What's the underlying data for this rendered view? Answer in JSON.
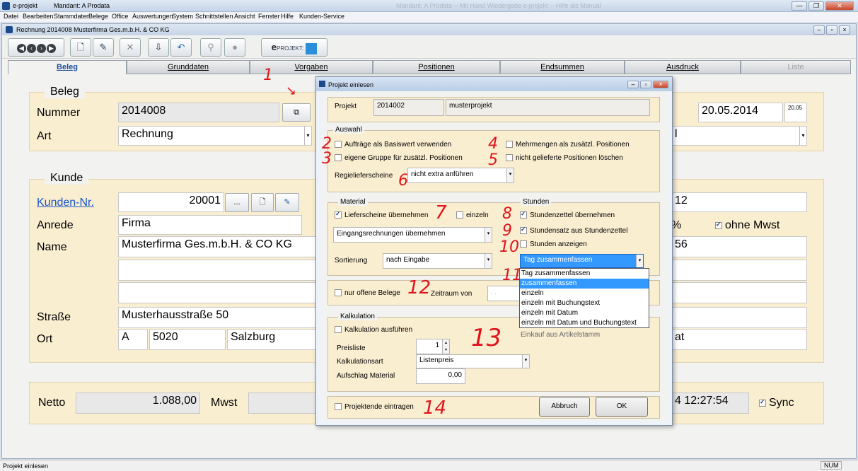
{
  "window": {
    "title": "e-projekt",
    "mandant": "Mandant: A Prodata",
    "ghost_title": "Mandant: A Prodata -- Mit Hand Wiedergabe e-projekt -- Hilfe als Manual"
  },
  "menu": [
    "Datei",
    "Bearbeiten",
    "Stammdaten",
    "Belege",
    "Office",
    "Auswertungen",
    "System",
    "Schnittstellen",
    "Ansicht",
    "Fenster",
    "Hilfe",
    "Kunden-Service"
  ],
  "document": {
    "title": "Rechnung  2014008  Musterfirma Ges.m.b.H. & CO KG",
    "logo_text": "PROJEKT:",
    "tabs": [
      {
        "label": "Beleg"
      },
      {
        "label": "Grunddaten"
      },
      {
        "label": "Vorgaben"
      },
      {
        "label": "Positionen"
      },
      {
        "label": "Endsummen"
      },
      {
        "label": "Ausdruck"
      },
      {
        "label": "Liste"
      }
    ],
    "beleg": {
      "title": "Beleg",
      "nummer_label": "Nummer",
      "nummer_value": "2014008",
      "art_label": "Art",
      "art_value": "Rechnung",
      "date_value": "20.05.2014",
      "time_value": "20.05",
      "right_partial": "l"
    },
    "kunde": {
      "title": "Kunde",
      "kunden_nr_label": "Kunden-Nr.",
      "kunden_nr_value": "20001",
      "kunden_nr_btn": "...",
      "anrede_label": "Anrede",
      "anrede_value": "Firma",
      "name_label": "Name",
      "name_value": "Musterfirma Ges.m.b.H. & CO KG",
      "strasse_label": "Straße",
      "strasse_value": "Musterhausstraße 50",
      "ort_label": "Ort",
      "land_value": "A",
      "plz_value": "5020",
      "ort_value": "Salzburg",
      "right_12": "12",
      "right_pct": "%",
      "ohne_mwst": "ohne Mwst",
      "right_56": "56",
      "right_at": "at"
    },
    "summen": {
      "netto_label": "Netto",
      "netto_value": "1.088,00",
      "mwst_label": "Mwst",
      "time_partial": "4 12:27:54",
      "sync_label": "Sync"
    }
  },
  "dialog": {
    "title": "Projekt einlesen",
    "projekt_label": "Projekt",
    "projekt_nr": "2014002",
    "projekt_name": "musterprojekt",
    "auswahl": {
      "title": "Auswahl",
      "auftraege": "Aufträge als Basiswert verwenden",
      "mehrmengen": "Mehrmengen als zusätzl. Positionen",
      "eigene_gruppe": "eigene Gruppe für zusätzl. Positionen",
      "nicht_geliefert": "nicht gelieferte Positionen löschen",
      "regie_label": "Regielieferscheine",
      "regie_value": "nicht extra anführen"
    },
    "material": {
      "title": "Material",
      "lieferscheine": "Lieferscheine übernehmen",
      "einzeln": "einzeln",
      "eingangsrechnungen": "Eingangsrechnungen übernehmen",
      "sortierung_label": "Sortierung",
      "sortierung_value": "nach Eingabe"
    },
    "stunden": {
      "title": "Stunden",
      "zettel": "Stundenzettel übernehmen",
      "satz": "Stundensatz aus Stundenzettel",
      "anzeigen": "Stunden anzeigen",
      "combo_value": "Tag zusammenfassen",
      "options": [
        "Tag zusammenfassen",
        "zusammenfassen",
        "einzeln",
        "einzeln mit Buchungstext",
        "einzeln mit Datum",
        "einzeln mit Datum und Buchungstext"
      ],
      "hidden_partial": "Einkauf aus Artikelstamm"
    },
    "offene": "nur offene Belege",
    "zeitraum": "Zeitraum  von",
    "zeitraum_value": ". .",
    "kalkulation": {
      "title": "Kalkulation",
      "ausfuehren": "Kalkulation ausführen",
      "preisliste_label": "Preisliste",
      "preisliste_value": "1",
      "art_label": "Kalkulationsart",
      "art_value": "Listenpreis",
      "aufschlag_label": "Aufschlag Material",
      "aufschlag_value": "0,00"
    },
    "projektende": "Projektende eintragen",
    "abbruch": "Abbruch",
    "ok": "OK"
  },
  "annotations": [
    "1",
    "2",
    "3",
    "4",
    "5",
    "6",
    "7",
    "8",
    "9",
    "10",
    "11",
    "12",
    "13",
    "14"
  ],
  "status": {
    "left": "Projekt einlesen",
    "right": "NUM"
  },
  "colors": {
    "panel": "#faeed1",
    "selection": "#3399ff",
    "annotation": "#e0141c",
    "link": "#1a55c8"
  }
}
